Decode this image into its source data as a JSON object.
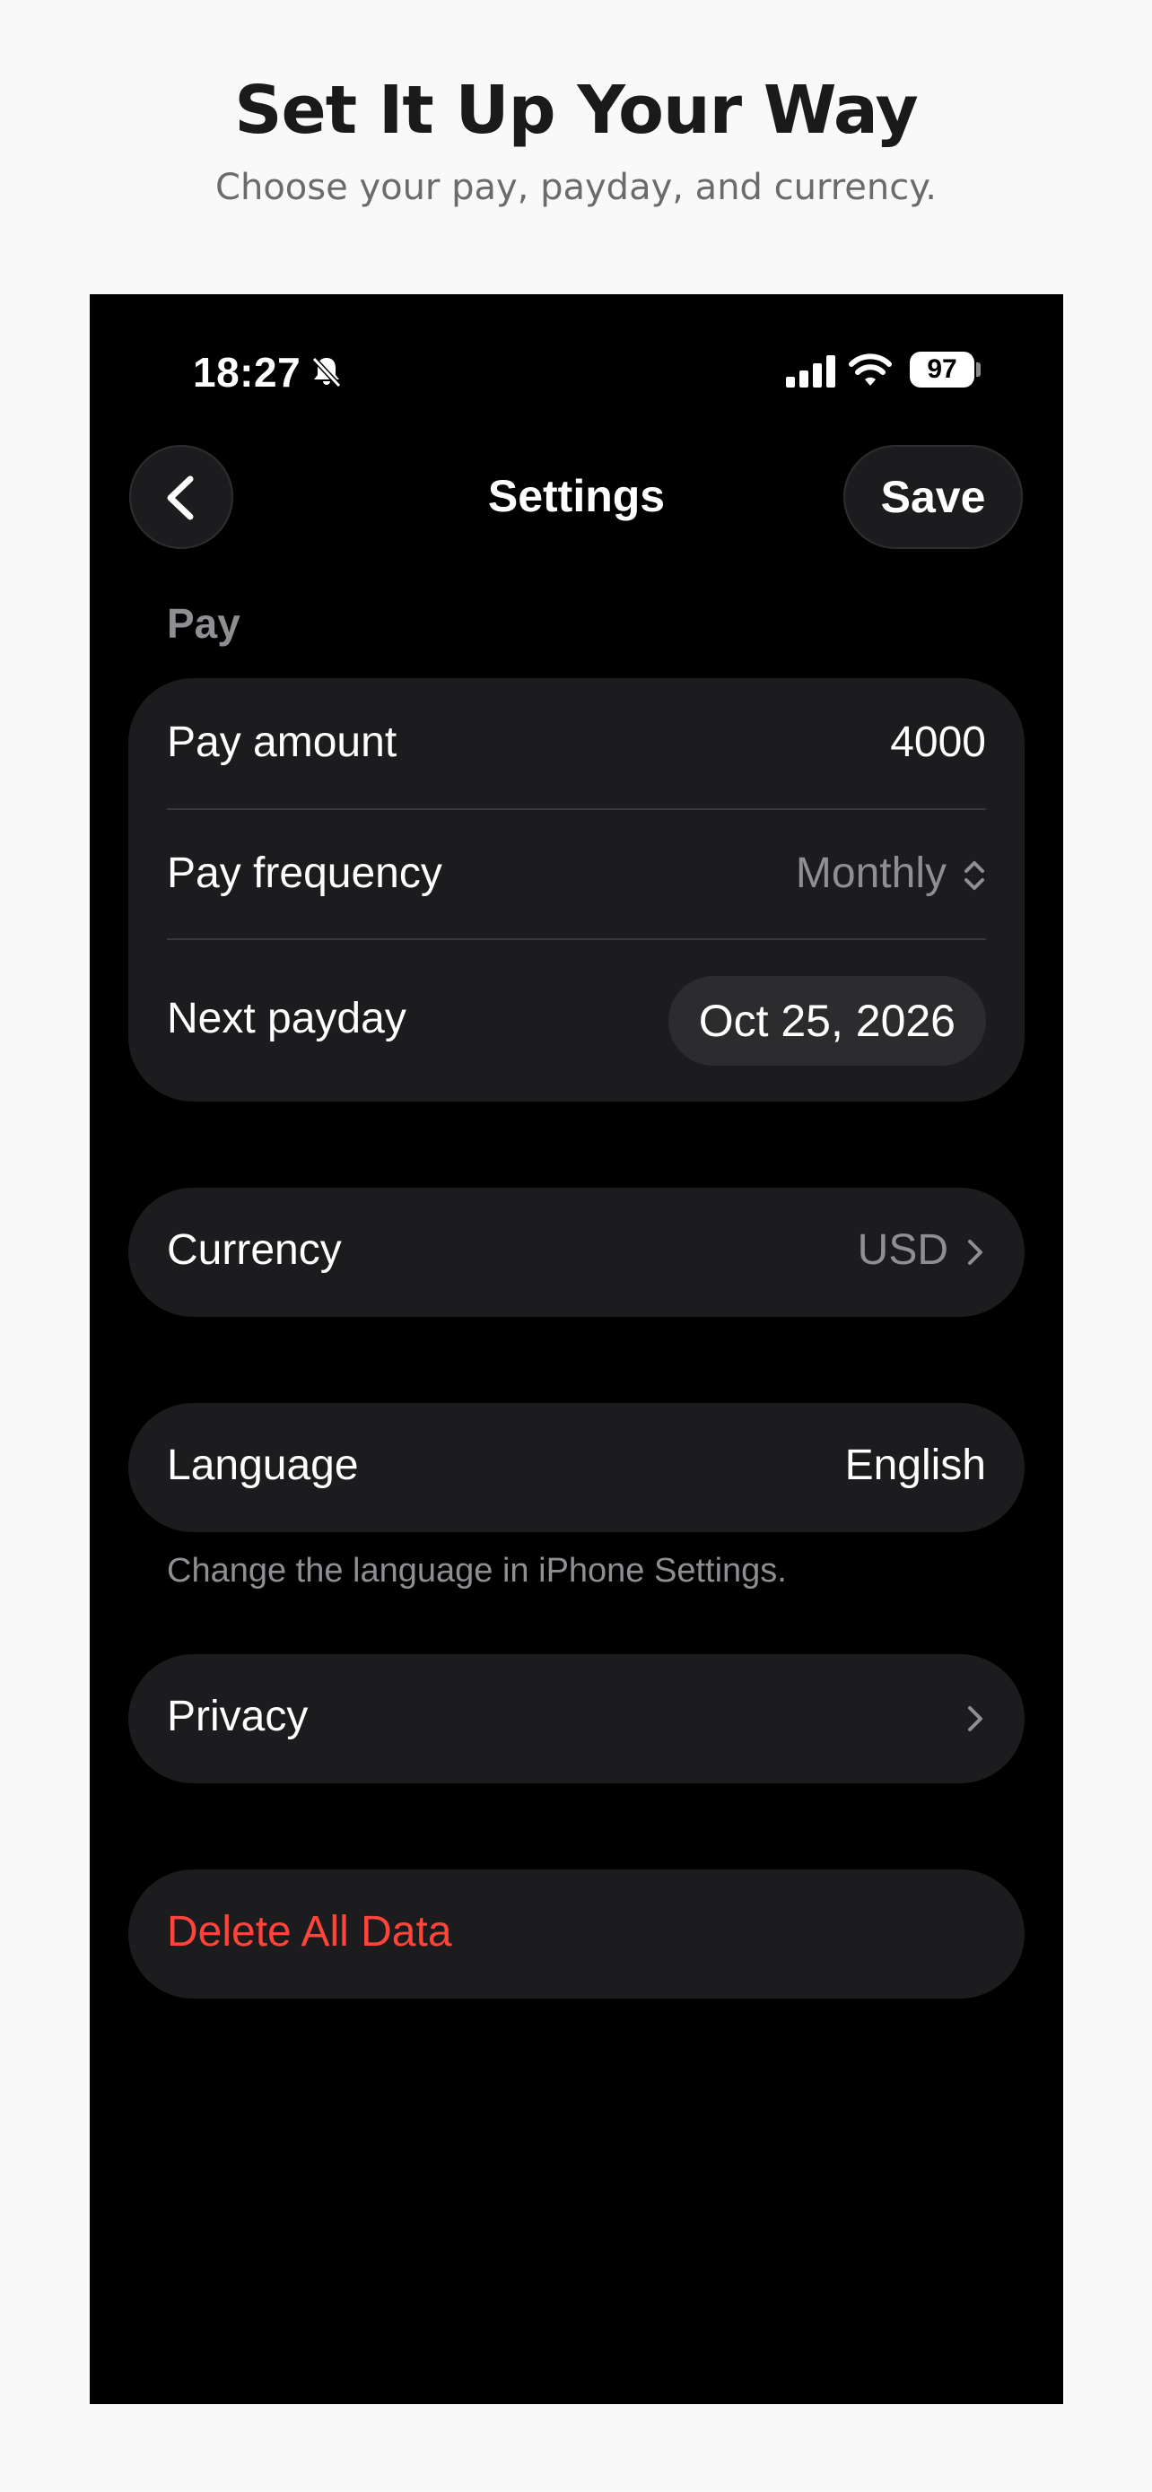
{
  "promo": {
    "headline": "Set It Up Your Way",
    "subheadline": "Choose your pay, payday, and currency."
  },
  "status_bar": {
    "time": "18:27",
    "battery": "97",
    "icons": [
      "bell-slash-icon",
      "cellular-signal-icon",
      "wifi-icon",
      "battery-icon"
    ]
  },
  "nav": {
    "back_icon": "chevron-left-icon",
    "title": "Settings",
    "save_label": "Save"
  },
  "pay_section": {
    "header": "Pay",
    "pay_amount_label": "Pay amount",
    "pay_amount_value": "4000",
    "pay_frequency_label": "Pay frequency",
    "pay_frequency_value": "Monthly",
    "next_payday_label": "Next payday",
    "next_payday_value": "Oct 25, 2026"
  },
  "currency": {
    "label": "Currency",
    "value": "USD"
  },
  "language": {
    "label": "Language",
    "value": "English",
    "footnote": "Change the language in iPhone Settings."
  },
  "privacy": {
    "label": "Privacy"
  },
  "danger": {
    "delete_label": "Delete All Data"
  },
  "colors": {
    "background": "#f9f9f9",
    "phone_background": "#000000",
    "card": "#1c1c1e",
    "secondary_text": "#8e8e93",
    "destructive": "#ff453a"
  }
}
